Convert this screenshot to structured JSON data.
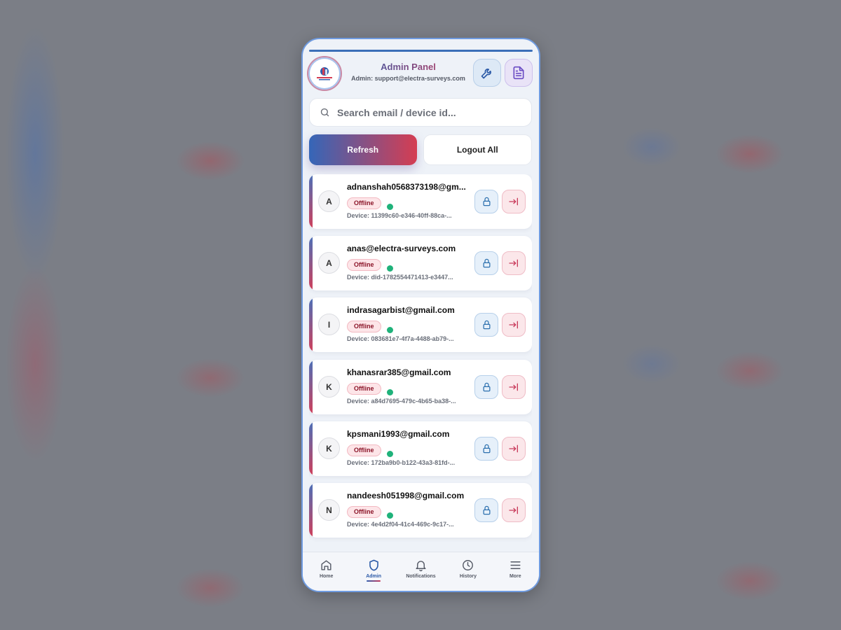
{
  "header": {
    "title": "Admin Panel",
    "subtitle": "Admin: support@electra-surveys.com",
    "logo_icon": "electra-surveys-logo",
    "tool_button_icon": "wrench-icon",
    "doc_button_icon": "document-icon"
  },
  "search": {
    "placeholder": "Search email / device id..."
  },
  "actions": {
    "refresh_label": "Refresh",
    "logout_all_label": "Logout All"
  },
  "users": [
    {
      "initial": "A",
      "email": "adnanshah0568373198@gm...",
      "status": "Offline",
      "device": "Device: 11399c60-e346-40ff-88ca-..."
    },
    {
      "initial": "A",
      "email": "anas@electra-surveys.com",
      "status": "Offline",
      "device": "Device: did-1782554471413-e3447..."
    },
    {
      "initial": "I",
      "email": "indrasagarbist@gmail.com",
      "status": "Offline",
      "device": "Device: 083681e7-4f7a-4488-ab79-..."
    },
    {
      "initial": "K",
      "email": "khanasrar385@gmail.com",
      "status": "Offline",
      "device": "Device: a84d7695-479c-4b65-ba38-..."
    },
    {
      "initial": "K",
      "email": "kpsmani1993@gmail.com",
      "status": "Offline",
      "device": "Device: 172ba9b0-b122-43a3-81fd-..."
    },
    {
      "initial": "N",
      "email": "nandeesh051998@gmail.com",
      "status": "Offline",
      "device": "Device: 4e4d2f04-41c4-469c-9c17-..."
    }
  ],
  "nav": [
    {
      "label": "Home",
      "icon": "home-icon"
    },
    {
      "label": "Admin",
      "icon": "shield-icon",
      "active": true
    },
    {
      "label": "Notifications",
      "icon": "bell-icon"
    },
    {
      "label": "History",
      "icon": "clock-icon"
    },
    {
      "label": "More",
      "icon": "menu-icon"
    }
  ],
  "colors": {
    "accent_blue": "#2f5fae",
    "accent_red": "#d53d52",
    "online_dot": "#1fb27a",
    "offline_badge": "#8b1428"
  }
}
